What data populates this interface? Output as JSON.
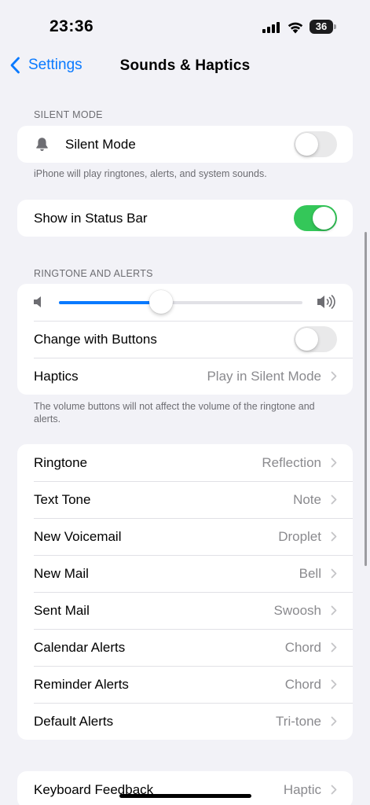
{
  "status_bar": {
    "time": "23:36",
    "battery": "36"
  },
  "nav": {
    "back_label": "Settings",
    "title": "Sounds & Haptics"
  },
  "silent_mode": {
    "header": "SILENT MODE",
    "label": "Silent Mode",
    "enabled": false,
    "footer": "iPhone will play ringtones, alerts, and system sounds."
  },
  "status_bar_setting": {
    "label": "Show in Status Bar",
    "enabled": true
  },
  "ringtone_alerts": {
    "header": "RINGTONE AND ALERTS",
    "volume_fraction": 0.42,
    "change_with_buttons": {
      "label": "Change with Buttons",
      "enabled": false
    },
    "haptics": {
      "label": "Haptics",
      "value": "Play in Silent Mode"
    },
    "footer": "The volume buttons will not affect the volume of the ringtone and alerts."
  },
  "sounds": [
    {
      "label": "Ringtone",
      "value": "Reflection"
    },
    {
      "label": "Text Tone",
      "value": "Note"
    },
    {
      "label": "New Voicemail",
      "value": "Droplet"
    },
    {
      "label": "New Mail",
      "value": "Bell"
    },
    {
      "label": "Sent Mail",
      "value": "Swoosh"
    },
    {
      "label": "Calendar Alerts",
      "value": "Chord"
    },
    {
      "label": "Reminder Alerts",
      "value": "Chord"
    },
    {
      "label": "Default Alerts",
      "value": "Tri-tone"
    }
  ],
  "keyboard_feedback": {
    "label": "Keyboard Feedback",
    "value": "Haptic"
  },
  "colors": {
    "accent": "#0a7aff",
    "toggle_on": "#34c759",
    "background": "#f2f2f7"
  }
}
